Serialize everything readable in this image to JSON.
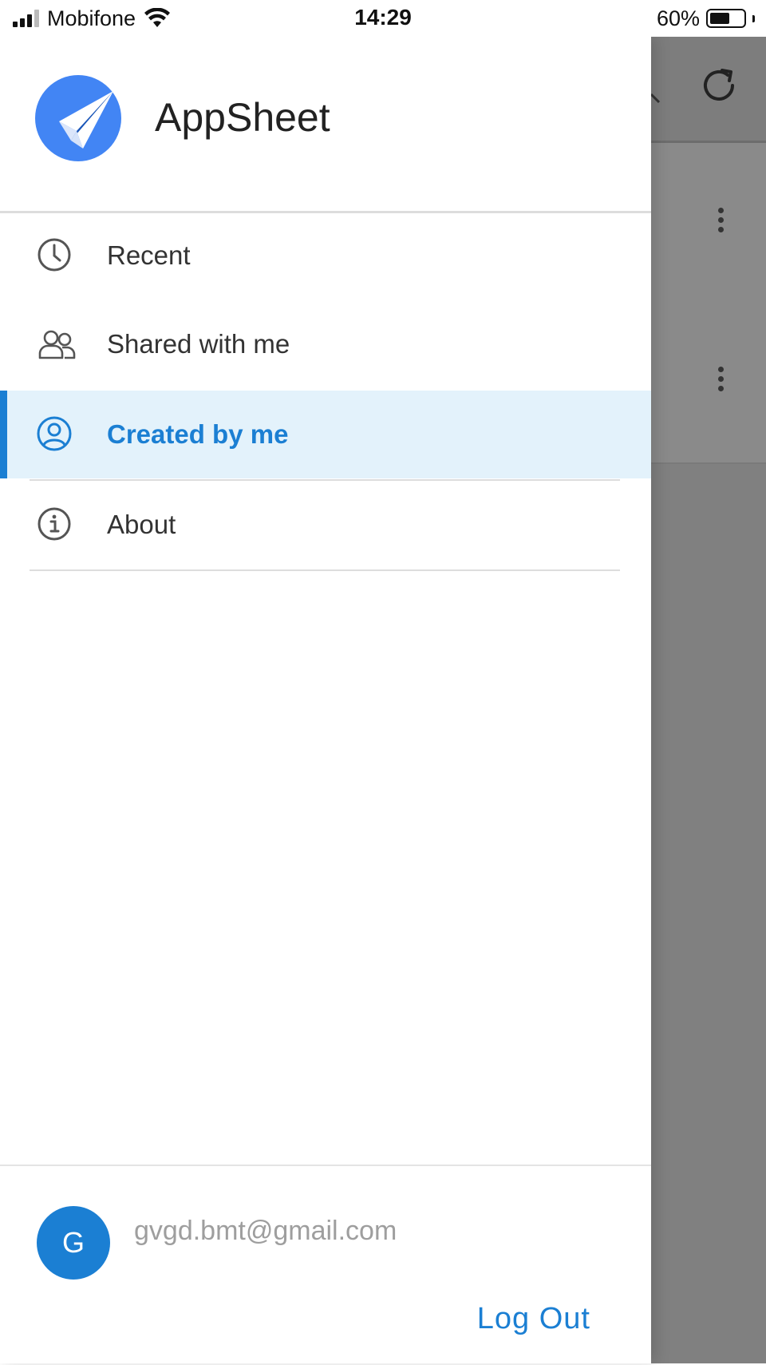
{
  "status_bar": {
    "carrier": "Mobifone",
    "time": "14:29",
    "battery_percent": "60%",
    "battery_level": 0.6,
    "signal_bars": 3
  },
  "drawer": {
    "app_name": "AppSheet",
    "logo_icon": "paper-plane-icon",
    "nav": [
      {
        "label": "Recent",
        "icon": "clock-icon",
        "active": false
      },
      {
        "label": "Shared with me",
        "icon": "people-icon",
        "active": false
      },
      {
        "label": "Created by me",
        "icon": "user-circle-icon",
        "active": true
      },
      {
        "label": "About",
        "icon": "info-icon",
        "active": false
      }
    ],
    "user": {
      "avatar_initial": "G",
      "email": "gvgd.bmt@gmail.com"
    },
    "logout_label": "Log Out"
  },
  "background_app": {
    "icons": [
      "refresh-icon",
      "more-vertical-icon"
    ]
  },
  "colors": {
    "accent": "#1b7fd3",
    "active_bg": "#e3f2fb",
    "logo_bg": "#4285f4",
    "overlay": "#808080"
  }
}
